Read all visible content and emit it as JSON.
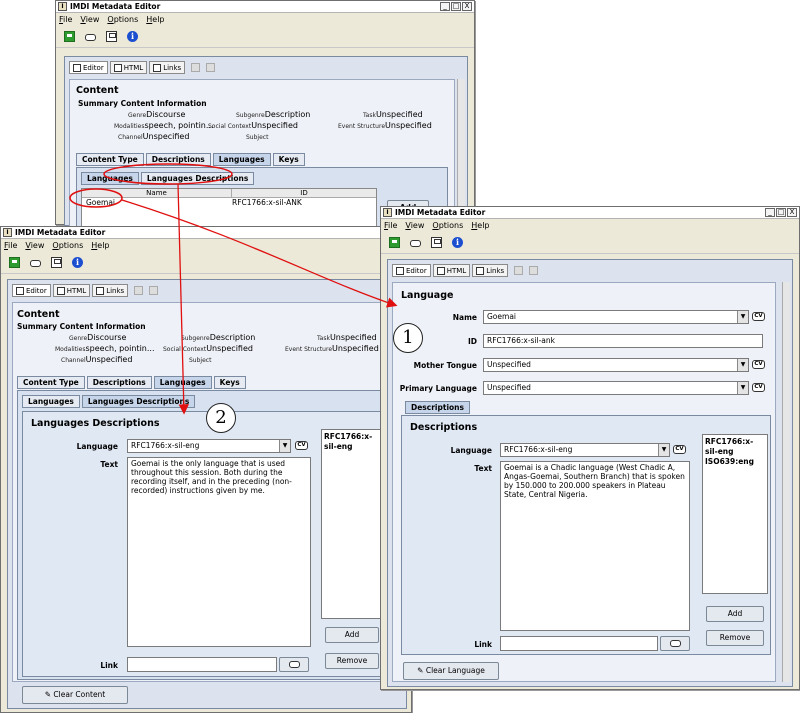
{
  "title": "IMDI Metadata Editor",
  "window_buttons": [
    "_",
    "□",
    "X"
  ],
  "menu": [
    "File",
    "View",
    "Options",
    "Help"
  ],
  "view_tabs": [
    "Editor",
    "HTML",
    "Links"
  ],
  "toolbar_icons": [
    "new-icon",
    "link-icon",
    "save-icon",
    "info-icon"
  ],
  "back_window": {
    "content_title": "Content",
    "summary_title": "Summary Content Information",
    "summary": {
      "genre_label": "Genre",
      "genre": "Discourse",
      "subgenre_label": "Subgenre",
      "subgenre": "Description",
      "task_label": "Task",
      "task": "Unspecified",
      "modalities_label": "Modalities",
      "modalities": "speech, pointin...",
      "social_context_label": "Social Context",
      "social_context": "Unspecified",
      "event_structure_label": "Event Structure",
      "event_structure": "Unspecified",
      "channel_label": "Channel",
      "channel": "Unspecified",
      "subject_label": "Subject",
      "subject": ""
    },
    "tabs": [
      "Content Type",
      "Descriptions",
      "Languages",
      "Keys"
    ],
    "subtabs": [
      "Languages",
      "Languages Descriptions"
    ],
    "table_headers": [
      "Name",
      "ID"
    ],
    "rows": [
      {
        "name": "Goemai",
        "id": "RFC1766:x-sil-ANK"
      }
    ],
    "add_label": "Add"
  },
  "left_window": {
    "content_title": "Content",
    "summary_title": "Summary Content Information",
    "summary": {
      "genre_label": "Genre",
      "genre": "Discourse",
      "subgenre_label": "Subgenre",
      "subgenre": "Description",
      "task_label": "Task",
      "task": "Unspecified",
      "modalities_label": "Modalities",
      "modalities": "speech, pointin...",
      "social_context_label": "Social Context",
      "social_context": "Unspecified",
      "event_structure_label": "Event Structure",
      "event_structure": "Unspecified",
      "channel_label": "Channel",
      "channel": "Unspecified",
      "subject_label": "Subject",
      "subject": ""
    },
    "tabs": [
      "Content Type",
      "Descriptions",
      "Languages",
      "Keys"
    ],
    "subtabs": [
      "Languages",
      "Languages Descriptions"
    ],
    "panel_title": "Languages Descriptions",
    "language_label": "Language",
    "language_value": "RFC1766:x-sil-eng",
    "text_label": "Text",
    "text_value": "Goemai is the only language that is used throughout this session. Both during the recording itself, and in the preceding (non-recorded) instructions given by me.",
    "link_label": "Link",
    "list_items": [
      "RFC1766:x-sil-eng"
    ],
    "add_label": "Add",
    "remove_label": "Remove",
    "clear_label": "Clear Content",
    "cv_label": "CV"
  },
  "right_window": {
    "section_title": "Language",
    "name_label": "Name",
    "name_value": "Goemai",
    "id_label": "ID",
    "id_value": "RFC1766:x-sil-ank",
    "mother_tongue_label": "Mother Tongue",
    "mother_tongue_value": "Unspecified",
    "primary_language_label": "Primary Language",
    "primary_language_value": "Unspecified",
    "tab": "Descriptions",
    "panel_title": "Descriptions",
    "language_label": "Language",
    "language_value": "RFC1766:x-sil-eng",
    "text_label": "Text",
    "text_value": "Goemai is a Chadic language (West Chadic A, Angas-Goemai, Southern Branch) that is spoken by 150.000 to 200.000 speakers in Plateau State, Central Nigeria.",
    "link_label": "Link",
    "list_items": [
      "RFC1766:x-sil-eng",
      "ISO639:eng"
    ],
    "add_label": "Add",
    "remove_label": "Remove",
    "clear_label": "Clear Language",
    "cv_label": "CV"
  },
  "annotations": {
    "one": "1",
    "two": "2",
    "color": "#e01010"
  }
}
